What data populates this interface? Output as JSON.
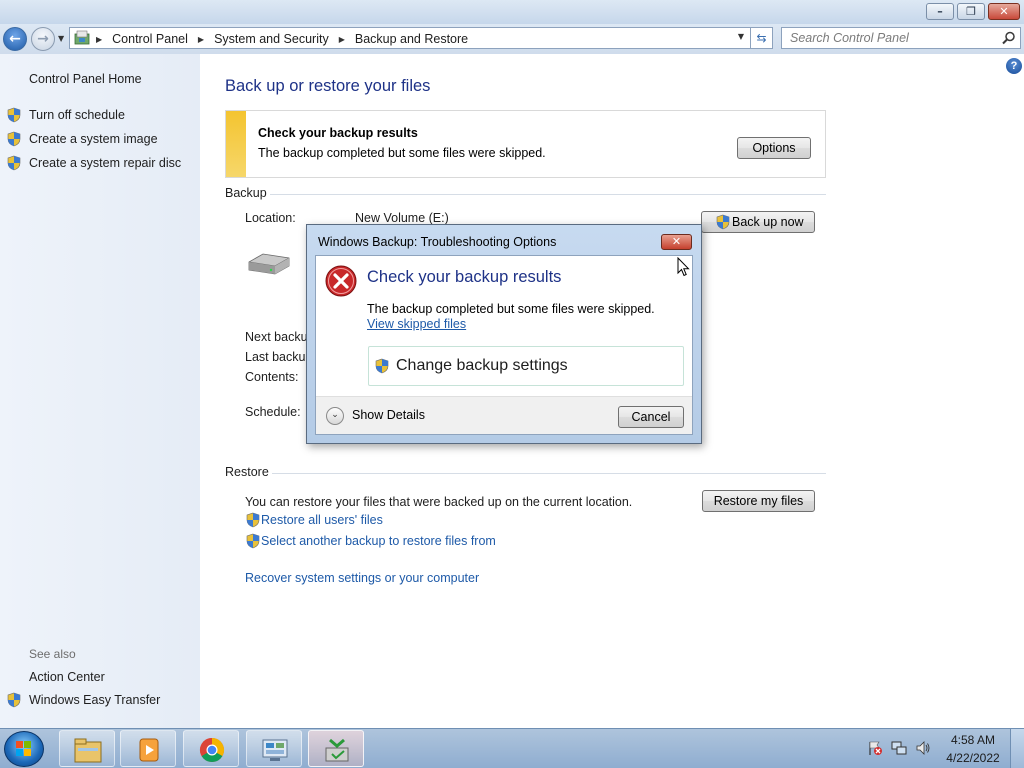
{
  "window": {
    "controls": {
      "minimize": "–",
      "restore": "❐",
      "close": "✕"
    }
  },
  "address": {
    "breadcrumbs": [
      "Control Panel",
      "System and Security",
      "Backup and Restore"
    ],
    "search_placeholder": "Search Control Panel"
  },
  "sidebar": {
    "home": "Control Panel Home",
    "tasks": [
      {
        "label": "Turn off schedule",
        "icon": "shield-icon"
      },
      {
        "label": "Create a system image",
        "icon": "shield-icon"
      },
      {
        "label": "Create a system repair disc",
        "icon": "shield-icon"
      }
    ],
    "see_also_label": "See also",
    "see_also": [
      {
        "label": "Action Center"
      },
      {
        "label": "Windows Easy Transfer",
        "icon": "shield-icon"
      }
    ]
  },
  "main": {
    "title": "Back up or restore your files",
    "notification": {
      "heading": "Check your backup results",
      "text": "The backup completed but some files were skipped.",
      "button": "Options",
      "accent_color": "#f4c430"
    },
    "backup": {
      "section": "Backup",
      "location_label": "Location:",
      "location_value": "New Volume (E:)",
      "backup_now": "Back up now",
      "next_backup_label": "Next backup",
      "last_backup_label": "Last backup",
      "contents_label": "Contents:",
      "schedule_label": "Schedule:"
    },
    "restore": {
      "section": "Restore",
      "text": "You can restore your files that were backed up on the current location.",
      "restore_button": "Restore my files",
      "restore_all": "Restore all users' files",
      "select_another": "Select another backup to restore files from",
      "recover": "Recover system settings or your computer"
    }
  },
  "dialog": {
    "title": "Windows Backup: Troubleshooting Options",
    "close": "✕",
    "heading": "Check your backup results",
    "message": "The backup completed but some files were skipped.",
    "link": "View skipped files",
    "command": "Change backup settings",
    "details": "Show Details",
    "cancel": "Cancel"
  },
  "taskbar": {
    "time": "4:58 AM",
    "date": "4/22/2022",
    "items": [
      "file-explorer-icon",
      "media-player-icon",
      "chrome-icon",
      "control-panel-icon",
      "backup-restore-icon"
    ]
  },
  "colors": {
    "link": "#1e5aa8",
    "heading": "#1e3287",
    "error": "#c8282a"
  }
}
